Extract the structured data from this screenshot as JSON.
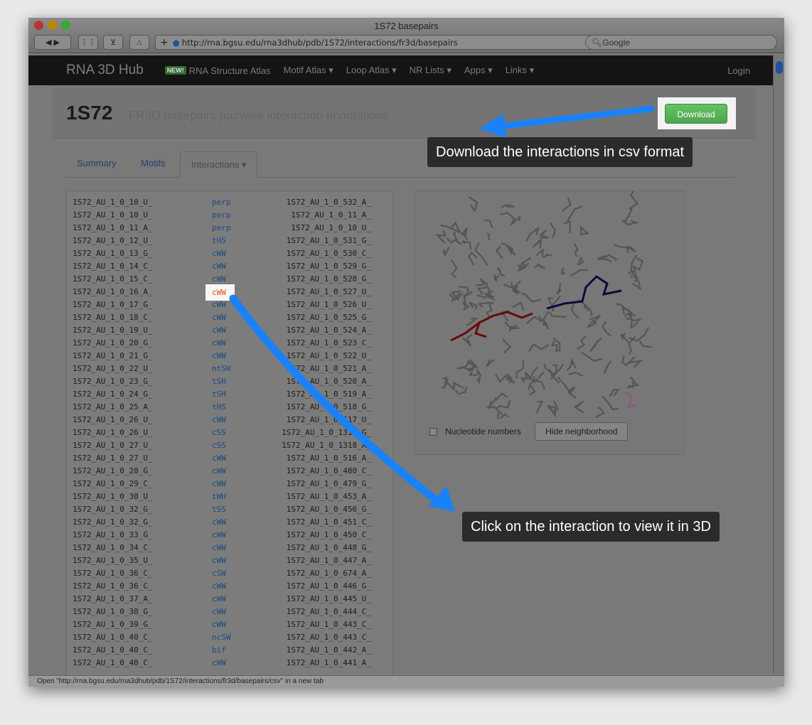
{
  "browser": {
    "title": "1S72 basepairs",
    "url": "http://rna.bgsu.edu/rna3dhub/pdb/1S72/interactions/fr3d/basepairs",
    "search_placeholder": "Google",
    "status": "Open \"http://rna.bgsu.edu/rna3dhub/pdb/1S72/interactions/fr3d/basepairs/csv\" in a new tab"
  },
  "nav": {
    "brand": "RNA 3D Hub",
    "new_badge": "NEW!",
    "items": [
      "RNA Structure Atlas",
      "Motif Atlas ▾",
      "Loop Atlas ▾",
      "NR Lists ▾",
      "Apps ▾",
      "Links ▾"
    ],
    "login": "Login"
  },
  "header": {
    "title": "1S72",
    "subtitle": "FR3D basepairs pairwise interaction annotations",
    "download": "Download"
  },
  "tabs": [
    "Summary",
    "Motifs",
    "Interactions ▾"
  ],
  "rows": [
    [
      "1S72_AU_1_0_10_U_",
      "perp",
      "1S72_AU_1_0_532_A_"
    ],
    [
      "1S72_AU_1_0_10_U_",
      "perp",
      "1S72_AU_1_0_11_A_"
    ],
    [
      "1S72_AU_1_0_11_A_",
      "perp",
      "1S72_AU_1_0_10_U_"
    ],
    [
      "1S72_AU_1_0_12_U_",
      "tHS",
      "1S72_AU_1_0_531_G_"
    ],
    [
      "1S72_AU_1_0_13_G_",
      "cWW",
      "1S72_AU_1_0_530_C_"
    ],
    [
      "1S72_AU_1_0_14_C_",
      "cWW",
      "1S72_AU_1_0_529_G_"
    ],
    [
      "1S72_AU_1_0_15_C_",
      "cWW",
      "1S72_AU_1_0_528_G_"
    ],
    [
      "1S72_AU_1_0_16_A_",
      "cWW",
      "1S72_AU_1_0_527_U_"
    ],
    [
      "1S72_AU_1_0_17_G_",
      "cWW",
      "1S72_AU_1_0_526_U_"
    ],
    [
      "1S72_AU_1_0_18_C_",
      "cWW",
      "1S72_AU_1_0_525_G_"
    ],
    [
      "1S72_AU_1_0_19_U_",
      "cWW",
      "1S72_AU_1_0_524_A_"
    ],
    [
      "1S72_AU_1_0_20_G_",
      "cWW",
      "1S72_AU_1_0_523_C_"
    ],
    [
      "1S72_AU_1_0_21_G_",
      "cWW",
      "1S72_AU_1_0_522_U_"
    ],
    [
      "1S72_AU_1_0_22_U_",
      "ntSH",
      "1S72_AU_1_0_521_A_"
    ],
    [
      "1S72_AU_1_0_23_G_",
      "tSH",
      "1S72_AU_1_0_520_A_"
    ],
    [
      "1S72_AU_1_0_24_G_",
      "tSH",
      "1S72_AU_1_0_519_A_"
    ],
    [
      "1S72_AU_1_0_25_A_",
      "tHS",
      "1S72_AU_1_0_518_G_"
    ],
    [
      "1S72_AU_1_0_26_U_",
      "cWW",
      "1S72_AU_1_0_517_U_"
    ],
    [
      "1S72_AU_1_0_26_U_",
      "cSS",
      "1S72_AU_1_0_1319_G_"
    ],
    [
      "1S72_AU_1_0_27_U_",
      "cSS",
      "1S72_AU_1_0_1318_A_"
    ],
    [
      "1S72_AU_1_0_27_U_",
      "cWW",
      "1S72_AU_1_0_516_A_"
    ],
    [
      "1S72_AU_1_0_28_G_",
      "cWW",
      "1S72_AU_1_0_480_C_"
    ],
    [
      "1S72_AU_1_0_29_C_",
      "cWW",
      "1S72_AU_1_0_479_G_"
    ],
    [
      "1S72_AU_1_0_30_U_",
      "tWH",
      "1S72_AU_1_0_453_A_"
    ],
    [
      "1S72_AU_1_0_32_G_",
      "tSS",
      "1S72_AU_1_0_456_G_"
    ],
    [
      "1S72_AU_1_0_32_G_",
      "cWW",
      "1S72_AU_1_0_451_C_"
    ],
    [
      "1S72_AU_1_0_33_G_",
      "cWW",
      "1S72_AU_1_0_450_C_"
    ],
    [
      "1S72_AU_1_0_34_C_",
      "cWW",
      "1S72_AU_1_0_448_G_"
    ],
    [
      "1S72_AU_1_0_35_U_",
      "cWW",
      "1S72_AU_1_0_447_A_"
    ],
    [
      "1S72_AU_1_0_36_C_",
      "cSW",
      "1S72_AU_1_0_674_A_"
    ],
    [
      "1S72_AU_1_0_36_C_",
      "cWW",
      "1S72_AU_1_0_446_G_"
    ],
    [
      "1S72_AU_1_0_37_A_",
      "cWW",
      "1S72_AU_1_0_445_U_"
    ],
    [
      "1S72_AU_1_0_38_G_",
      "cWW",
      "1S72_AU_1_0_444_C_"
    ],
    [
      "1S72_AU_1_0_39_G_",
      "cWW",
      "1S72_AU_1_0_443_C_"
    ],
    [
      "1S72_AU_1_0_40_C_",
      "ncSW",
      "1S72_AU_1_0_443_C_"
    ],
    [
      "1S72_AU_1_0_40_C_",
      "bif",
      "1S72_AU_1_0_442_A_"
    ],
    [
      "1S72_AU_1_0_40_C_",
      "cWW",
      "1S72_AU_1_0_441_A_"
    ]
  ],
  "viewer": {
    "nucleotide_numbers": "Nucleotide numbers",
    "hide_neighborhood": "Hide neighborhood"
  },
  "callouts": {
    "download_tip": "Download the interactions in csv format",
    "click_tip": "Click on the interaction to view it in 3D",
    "highlighted": "cWW"
  },
  "colors": {
    "arrow": "#1a82f7",
    "download": "#5bb75b",
    "highlight_text": "#e8501a"
  }
}
